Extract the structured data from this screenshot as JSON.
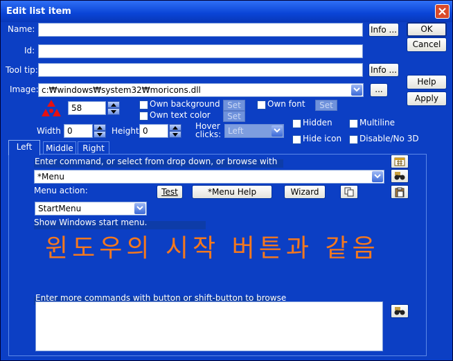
{
  "window": {
    "title": "Edit list item"
  },
  "right_buttons": {
    "ok": "OK",
    "cancel": "Cancel",
    "help": "Help",
    "apply": "Apply"
  },
  "fields": {
    "name_label": "Name:",
    "name_value": "",
    "id_label": "Id:",
    "id_value": "",
    "tooltip_label": "Tool tip:",
    "tooltip_value": "",
    "image_label": "Image:",
    "image_value": "c:₩windows₩system32₩moricons.dll",
    "info_label": "Info ...",
    "browse_label": "..."
  },
  "image_settings": {
    "icon_index": "58",
    "width_label": "Width",
    "width_value": "0",
    "height_label": "Height",
    "height_value": "0",
    "own_background": "Own background",
    "own_text_color": "Own text color",
    "own_font": "Own font",
    "set_label": "Set",
    "hover_clicks_line1": "Hover",
    "hover_clicks_line2": "clicks:",
    "hover_value": "Left",
    "hidden": "Hidden",
    "multiline": "Multiline",
    "hide_icon": "Hide icon",
    "disable_3d": "Disable/No 3D"
  },
  "tabs": [
    {
      "label": "Left"
    },
    {
      "label": "Middle"
    },
    {
      "label": "Right"
    }
  ],
  "panel": {
    "command_prompt": "Enter command, or select from drop down, or browse with",
    "command_value": "*Menu",
    "menu_action_label": "Menu action:",
    "menu_action_value": "StartMenu",
    "test_label": "Test",
    "menu_help_label": "*Menu Help",
    "wizard_label": "Wizard",
    "description": "Show Windows start menu.",
    "korean_note": "윈도우의 시작 버튼과 같음",
    "more_commands_prompt": "Enter more commands with button or shift-button to browse",
    "more_commands_value": ""
  }
}
